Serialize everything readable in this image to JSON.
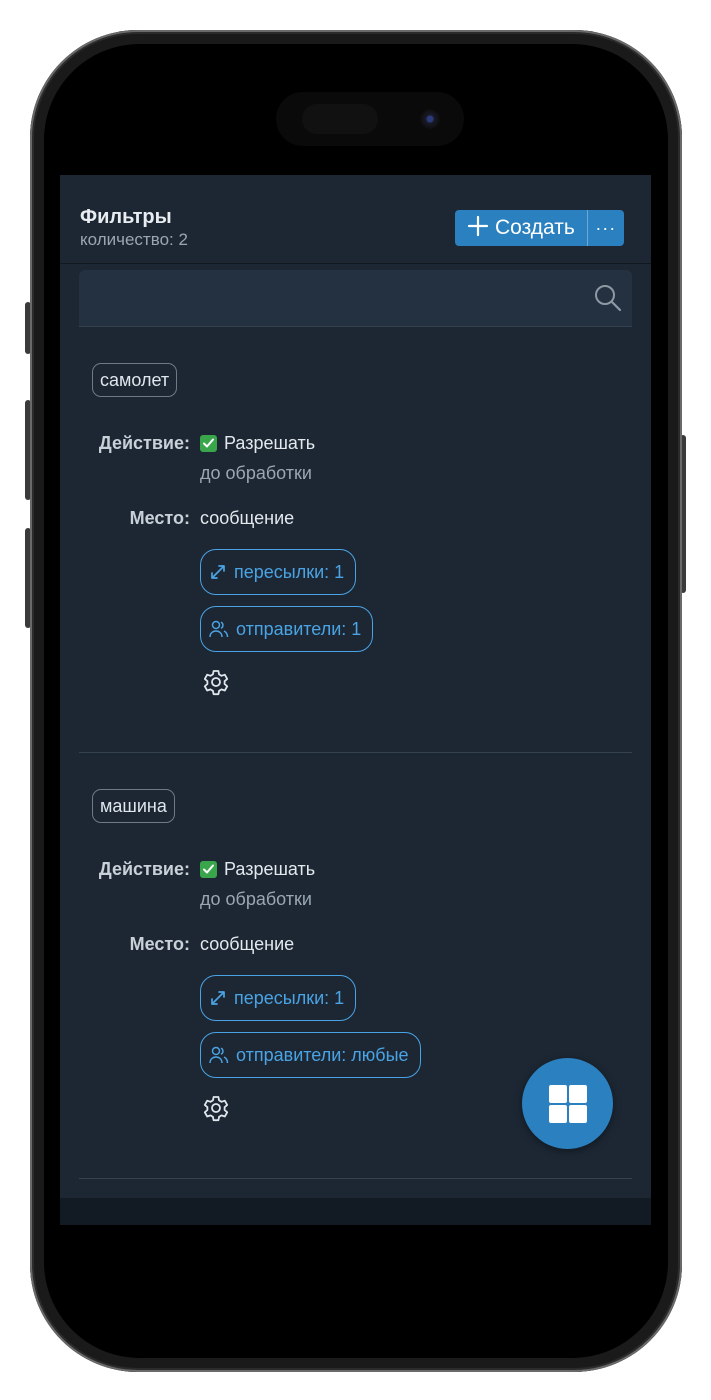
{
  "header": {
    "title": "Фильтры",
    "subtitle": "количество: 2",
    "create_label": "Создать",
    "more_label": "···"
  },
  "search": {
    "placeholder": "",
    "value": ""
  },
  "filters": [
    {
      "tag": "самолет",
      "action_label": "Действие:",
      "action_value": "Разрешать",
      "action_note": "до обработки",
      "place_label": "Место:",
      "place_value": "сообщение",
      "forwards_chip": "пересылки: 1",
      "senders_chip": "отправители: 1"
    },
    {
      "tag": "машина",
      "action_label": "Действие:",
      "action_value": "Разрешать",
      "action_note": "до обработки",
      "place_label": "Место:",
      "place_value": "сообщение",
      "forwards_chip": "пересылки: 1",
      "senders_chip": "отправители: любые"
    }
  ],
  "icons": {
    "search": "search-icon",
    "check": "check-icon",
    "forwards": "arrows-expand-icon",
    "senders": "users-icon",
    "settings": "gear-icon",
    "fab": "grid-icon"
  },
  "colors": {
    "accent": "#2b80c0",
    "chip": "#4aa3e4",
    "background": "#1c2733",
    "check": "#3aa64b"
  }
}
